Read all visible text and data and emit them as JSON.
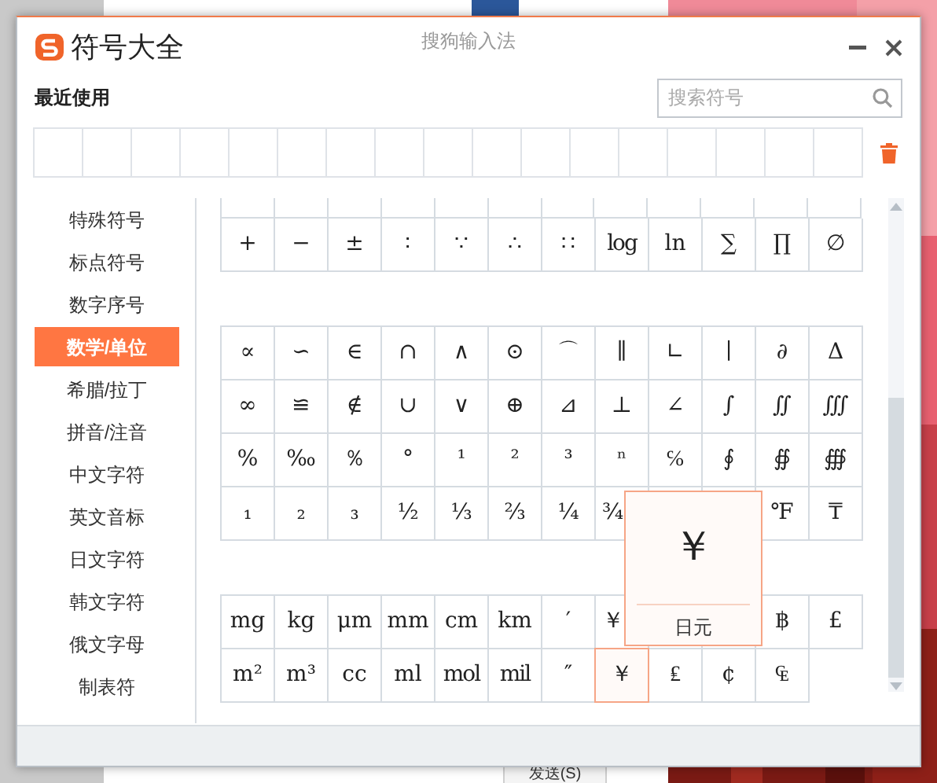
{
  "background": {
    "send_button": "发送(S)"
  },
  "dialog": {
    "title": "符号大全",
    "app_name": "搜狗输入法"
  },
  "recent": {
    "label": "最近使用"
  },
  "search": {
    "placeholder": "搜索符号"
  },
  "categories": [
    {
      "label": "特殊符号",
      "selected": false
    },
    {
      "label": "标点符号",
      "selected": false
    },
    {
      "label": "数字序号",
      "selected": false
    },
    {
      "label": "数学/单位",
      "selected": true
    },
    {
      "label": "希腊/拉丁",
      "selected": false
    },
    {
      "label": "拼音/注音",
      "selected": false
    },
    {
      "label": "中文字符",
      "selected": false
    },
    {
      "label": "英文音标",
      "selected": false
    },
    {
      "label": "日文字符",
      "selected": false
    },
    {
      "label": "韩文字符",
      "selected": false
    },
    {
      "label": "俄文字母",
      "selected": false
    },
    {
      "label": "制表符",
      "selected": false
    }
  ],
  "symbol_groups": [
    {
      "rows": [
        [
          {
            "symbol": "+",
            "selected": false
          },
          {
            "symbol": "−",
            "selected": false
          },
          {
            "symbol": "±",
            "selected": false
          },
          {
            "symbol": "∶",
            "selected": false
          },
          {
            "symbol": "∵",
            "selected": false
          },
          {
            "symbol": "∴",
            "selected": false
          },
          {
            "symbol": "∷",
            "selected": false
          },
          {
            "symbol": "log",
            "selected": false
          },
          {
            "symbol": "ln",
            "selected": false
          },
          {
            "symbol": "∑",
            "selected": false
          },
          {
            "symbol": "∏",
            "selected": false
          },
          {
            "symbol": "∅",
            "selected": false
          }
        ]
      ]
    },
    {
      "rows": [
        [
          {
            "symbol": "∝",
            "selected": false
          },
          {
            "symbol": "∽",
            "selected": false
          },
          {
            "symbol": "∈",
            "selected": false
          },
          {
            "symbol": "∩",
            "selected": false
          },
          {
            "symbol": "∧",
            "selected": false
          },
          {
            "symbol": "⊙",
            "selected": false
          },
          {
            "symbol": "⌒",
            "selected": false
          },
          {
            "symbol": "∥",
            "selected": false
          },
          {
            "symbol": "∟",
            "selected": false
          },
          {
            "symbol": "∣",
            "selected": false
          },
          {
            "symbol": "∂",
            "selected": false
          },
          {
            "symbol": "Δ",
            "selected": false
          }
        ],
        [
          {
            "symbol": "∞",
            "selected": false
          },
          {
            "symbol": "≌",
            "selected": false
          },
          {
            "symbol": "∉",
            "selected": false
          },
          {
            "symbol": "∪",
            "selected": false
          },
          {
            "symbol": "∨",
            "selected": false
          },
          {
            "symbol": "⊕",
            "selected": false
          },
          {
            "symbol": "⊿",
            "selected": false
          },
          {
            "symbol": "⊥",
            "selected": false
          },
          {
            "symbol": "∠",
            "selected": false
          },
          {
            "symbol": "∫",
            "selected": false
          },
          {
            "symbol": "∬",
            "selected": false
          },
          {
            "symbol": "∭",
            "selected": false
          }
        ],
        [
          {
            "symbol": "%",
            "selected": false
          },
          {
            "symbol": "‰",
            "selected": false
          },
          {
            "symbol": "％",
            "selected": false
          },
          {
            "symbol": "°",
            "selected": false
          },
          {
            "symbol": "¹",
            "selected": false
          },
          {
            "symbol": "²",
            "selected": false
          },
          {
            "symbol": "³",
            "selected": false
          },
          {
            "symbol": "ⁿ",
            "selected": false
          },
          {
            "symbol": "℅",
            "selected": false
          },
          {
            "symbol": "∮",
            "selected": false
          },
          {
            "symbol": "∯",
            "selected": false
          },
          {
            "symbol": "∰",
            "selected": false
          }
        ],
        [
          {
            "symbol": "₁",
            "selected": false
          },
          {
            "symbol": "₂",
            "selected": false
          },
          {
            "symbol": "₃",
            "selected": false
          },
          {
            "symbol": "½",
            "selected": false
          },
          {
            "symbol": "⅓",
            "selected": false
          },
          {
            "symbol": "⅔",
            "selected": false
          },
          {
            "symbol": "¼",
            "selected": false
          },
          {
            "symbol": "¾",
            "selected": false,
            "kind": "partial"
          },
          null,
          null,
          {
            "symbol": "℉",
            "selected": false
          },
          {
            "symbol": "₸",
            "selected": false
          }
        ]
      ]
    },
    {
      "rows": [
        [
          {
            "symbol": "mg",
            "selected": false
          },
          {
            "symbol": "kg",
            "selected": false
          },
          {
            "symbol": "μm",
            "selected": false
          },
          {
            "symbol": "mm",
            "selected": false
          },
          {
            "symbol": "cm",
            "selected": false
          },
          {
            "symbol": "km",
            "selected": false
          },
          {
            "symbol": "′",
            "selected": false
          },
          {
            "symbol": "￥",
            "selected": false,
            "kind": "partial"
          },
          null,
          null,
          {
            "symbol": "฿",
            "selected": false
          },
          {
            "symbol": "£",
            "selected": false
          }
        ],
        [
          {
            "symbol": "m²",
            "selected": false
          },
          {
            "symbol": "m³",
            "selected": false
          },
          {
            "symbol": "cc",
            "selected": false
          },
          {
            "symbol": "ml",
            "selected": false
          },
          {
            "symbol": "mol",
            "selected": false
          },
          {
            "symbol": "mil",
            "selected": false
          },
          {
            "symbol": "″",
            "selected": false
          },
          {
            "symbol": "￥",
            "selected": true
          },
          {
            "symbol": "₤",
            "selected": false
          },
          {
            "symbol": "¢",
            "selected": false
          },
          {
            "symbol": "₠",
            "selected": false
          }
        ]
      ]
    }
  ],
  "tooltip": {
    "symbol": "￥",
    "name": "日元"
  }
}
